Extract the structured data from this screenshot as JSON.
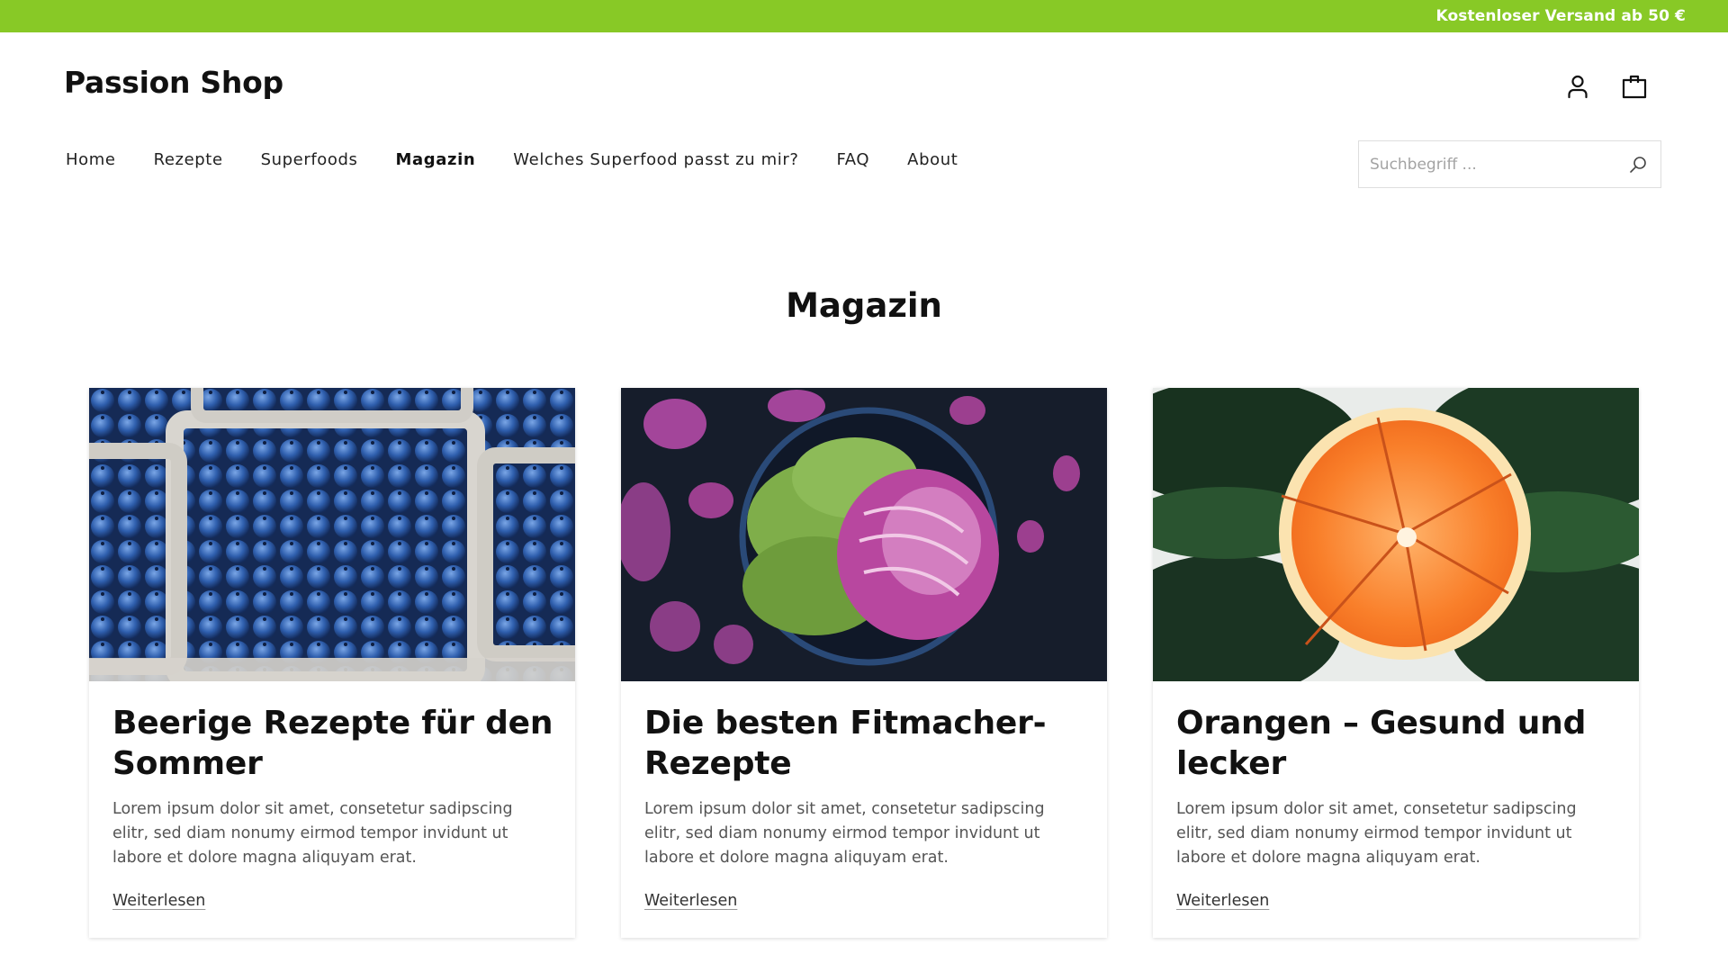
{
  "topbar": {
    "text": "Kostenloser Versand ab 50 €",
    "color": "#88c926"
  },
  "header": {
    "logo": "Passion Shop",
    "icons": [
      "account-icon",
      "shopping-bag-icon"
    ]
  },
  "nav": {
    "items": [
      {
        "label": "Home",
        "active": false
      },
      {
        "label": "Rezepte",
        "active": false
      },
      {
        "label": "Superfoods",
        "active": false
      },
      {
        "label": "Magazin",
        "active": true
      },
      {
        "label": "Welches Superfood passt zu mir?",
        "active": false
      },
      {
        "label": "FAQ",
        "active": false
      },
      {
        "label": "About",
        "active": false
      }
    ]
  },
  "search": {
    "placeholder": "Suchbegriff ...",
    "value": "",
    "icon": "search-icon"
  },
  "main": {
    "title": "Magazin",
    "cards": [
      {
        "image": "blueberries-image",
        "title": "Beerige Rezepte für den Sommer",
        "text": "Lorem ipsum dolor sit amet, consetetur sadipscing elitr, sed diam nonumy eirmod tempor invidunt ut labore et dolore magna aliquyam erat.",
        "link": "Weiterlesen"
      },
      {
        "image": "red-lettuce-image",
        "title": "Die besten Fitmacher-Rezepte",
        "text": "Lorem ipsum dolor sit amet, consetetur sadipscing elitr, sed diam nonumy eirmod tempor invidunt ut labore et dolore magna aliquyam erat.",
        "link": "Weiterlesen"
      },
      {
        "image": "orange-image",
        "title": "Orangen – Gesund und lecker",
        "text": "Lorem ipsum dolor sit amet, consetetur sadipscing elitr, sed diam nonumy eirmod tempor invidunt ut labore et dolore magna aliquyam erat.",
        "link": "Weiterlesen"
      }
    ]
  }
}
